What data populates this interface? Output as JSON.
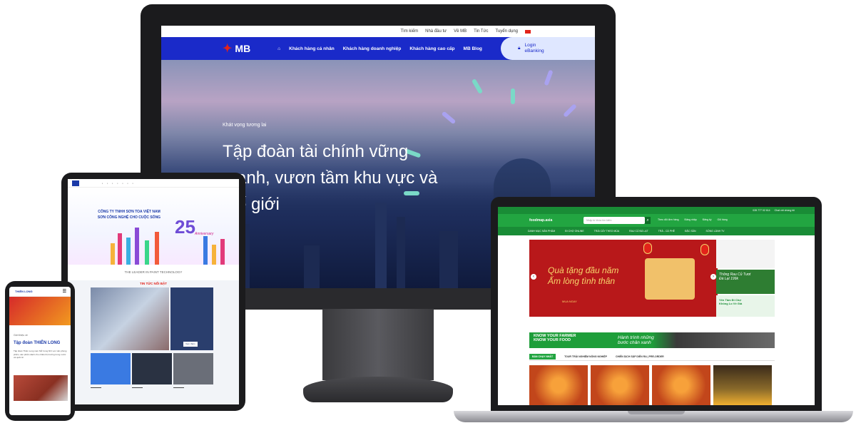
{
  "mb": {
    "util": [
      "Tìm kiếm",
      "Nhà đầu tư",
      "Về MB",
      "Tin Tức",
      "Tuyển dụng"
    ],
    "brand": "MB",
    "menu": [
      "Khách hàng cá nhân",
      "Khách hàng doanh nghiệp",
      "Khách hàng cao cấp",
      "MB Blog"
    ],
    "login": "Login\neBanking",
    "kicker": "Khát vọng tương lai",
    "title": "Tập đoàn tài chính vững mạnh, vươn tầm khu vực và thế giới",
    "colors": {
      "primary": "#1a2ac9",
      "accent": "#e2231a"
    }
  },
  "toa": {
    "hero_title": "CÔNG TY TNHH SƠN TOA VIỆT NAM\nSƠN CÔNG NGHỆ CHO CUỘC SỐNG",
    "anniv_num": "25",
    "anniv_label": "Anniversary",
    "tagline": "THE LEADER IN PAINT TECHNOLOGY",
    "news_heading": "TIN TỨC NỔI BẬT",
    "news_btn": "Xem thêm"
  },
  "phone": {
    "brand": "THIÊN LONG",
    "kicker": "Giới thiệu về",
    "title": "Tập đoàn THIÊN LONG",
    "text": "Tập đoàn Thiên Long nam Mở trong lĩnh vực văn phòng phẩm, sản phẩm dành cho nhiều thị trường trong nước và quốc tế"
  },
  "foodmap": {
    "logo": "foodmap.asia",
    "hotline": "028 777 02 614",
    "util": [
      "Chat với chúng tôi"
    ],
    "search_placeholder": "Nhập từ khóa tìm kiếm",
    "header_items": [
      "Theo dõi đơn hàng",
      "Đăng nhập",
      "Đăng ký",
      "Giỏ hàng"
    ],
    "categories": [
      "DANH MỤC SẢN PHẨM",
      "ĐI CHỢ ONLINE",
      "TRÁI CÂY THEO MÙA",
      "RAU CỦ ĐÀ LẠT",
      "TRÀ - CÀ PHÊ",
      "ĐẶC SẢN",
      "SỐNG LÀNH TV"
    ],
    "banner_title": "Quà tặng đầu năm\nẤm lòng tình thân",
    "banner_btn": "MUA NGAY",
    "side_a": "Thông Rau Củ Tươi\nĐà Lạt 199k",
    "side_b": "Yên Tâm Đi Chợ\nKhông Lo Về Giá",
    "strip_a": "KNOW YOUR FARMER\nKNOW YOUR FOOD",
    "strip_b": "Hành trình những\nbước chân xanh",
    "tabs": [
      "BÁN CHẠY NHẤT",
      "TOUR TRẢI NGHIỆM NÔNG NGHIỆP",
      "CHIẾN DỊCH SẮP DIỄN RA | PRE-ORDER"
    ],
    "colors": {
      "primary": "#22a541",
      "dark": "#198c36"
    }
  }
}
